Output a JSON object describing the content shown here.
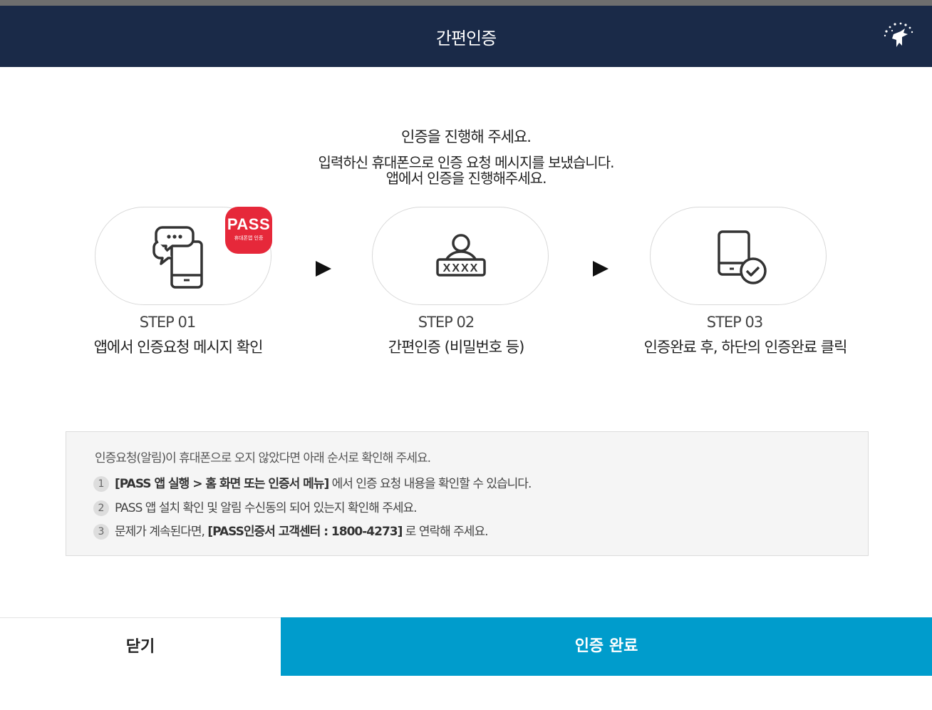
{
  "header": {
    "title": "간편인증",
    "logo_icon": "pegasus-logo-icon"
  },
  "intro": {
    "line1": "인증을 진행해 주세요.",
    "line2": "입력하신 휴대폰으로 인증 요청 메시지를 보냈습니다.",
    "line3": "앱에서 인증을 진행해주세요."
  },
  "badge": {
    "title": "PASS",
    "subtitle": "휴대폰앱 인증"
  },
  "steps": [
    {
      "num": "STEP 01",
      "desc": "앱에서 인증요청 메시지 확인",
      "icon": "phone-message-icon"
    },
    {
      "num": "STEP 02",
      "desc": "간편인증 (비밀번호 등)",
      "icon": "user-password-icon",
      "mask": "XXXX"
    },
    {
      "num": "STEP 03",
      "desc": "인증완료 후, 하단의 인증완료 클릭",
      "icon": "phone-check-icon"
    }
  ],
  "notice": {
    "lead": "인증요청(알림)이 휴대폰으로 오지 않았다면 아래 순서로 확인해 주세요.",
    "items": [
      {
        "num": "1",
        "bold": "[PASS 앱 실행 > 홈 화면 또는 인증서 메뉴]",
        "text": " 에서 인증 요청 내용을 확인할 수 있습니다."
      },
      {
        "num": "2",
        "text": "PASS 앱 설치 확인 및 알림 수신동의 되어 있는지 확인해 주세요."
      },
      {
        "num": "3",
        "pre": "문제가 계속된다면, ",
        "bold": "[PASS인증서 고객센터 : 1800-4273]",
        "text": " 로 연락해 주세요."
      }
    ]
  },
  "buttons": {
    "close": "닫기",
    "done": "인증 완료"
  },
  "colors": {
    "header_bg": "#1a2a48",
    "primary": "#009ccc",
    "badge": "#e6283a"
  }
}
